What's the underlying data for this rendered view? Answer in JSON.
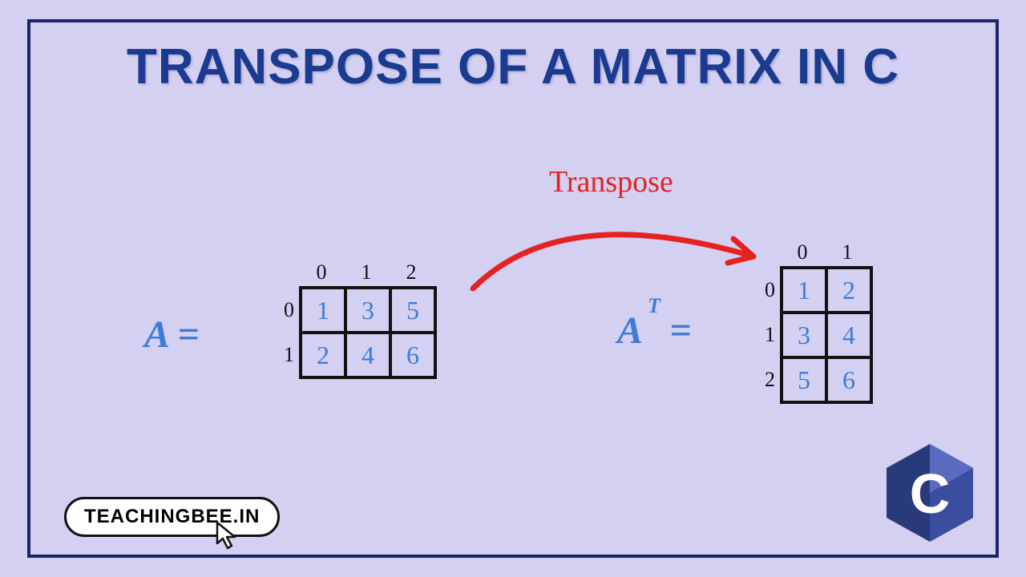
{
  "title": "TRANSPOSE OF A MATRIX IN C",
  "transpose_label": "Transpose",
  "eq_left": "A =",
  "eq_right_a": "A",
  "eq_right_t": "T",
  "eq_right_eq": "=",
  "matrix_a": {
    "col_headers": [
      "0",
      "1",
      "2"
    ],
    "row_headers": [
      "0",
      "1"
    ],
    "data": [
      [
        "1",
        "3",
        "5"
      ],
      [
        "2",
        "4",
        "6"
      ]
    ]
  },
  "matrix_at": {
    "col_headers": [
      "0",
      "1"
    ],
    "row_headers": [
      "0",
      "1",
      "2"
    ],
    "data": [
      [
        "1",
        "2"
      ],
      [
        "3",
        "4"
      ],
      [
        "5",
        "6"
      ]
    ]
  },
  "badge": "TEACHINGBEE.IN",
  "c_logo_letter": "C",
  "colors": {
    "bg": "#d4d0f2",
    "title": "#1a3b8f",
    "accent_red": "#e52222",
    "accent_blue": "#3b7dd8",
    "frame": "#1a2766"
  }
}
